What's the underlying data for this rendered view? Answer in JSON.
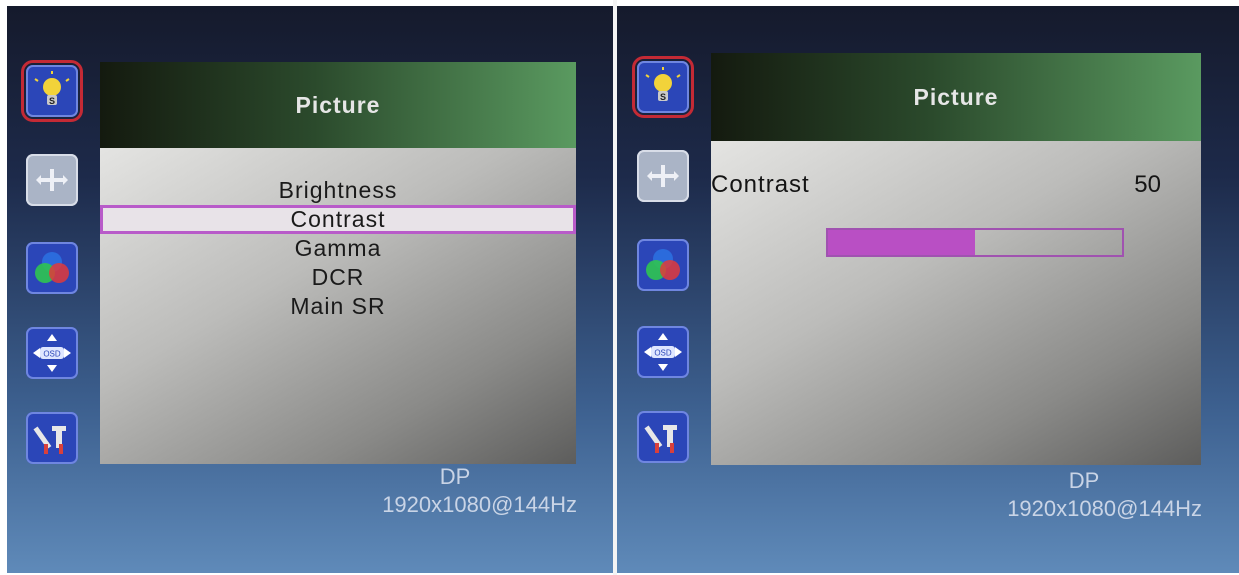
{
  "left_screen": {
    "menu_title": "Picture",
    "menu_items": [
      {
        "label": "Brightness"
      },
      {
        "label": "Contrast"
      },
      {
        "label": "Gamma"
      },
      {
        "label": "DCR"
      },
      {
        "label": "Main SR"
      }
    ],
    "selected_item": "Contrast",
    "source": "DP",
    "resolution": "1920x1080@144Hz"
  },
  "right_screen": {
    "menu_title": "Picture",
    "setting_label": "Contrast",
    "setting_value": "50",
    "setting_level_percent": 50,
    "source": "DP",
    "resolution": "1920x1080@144Hz"
  },
  "icon_bar": [
    {
      "name": "picture-icon",
      "badge": "S",
      "selected": true
    },
    {
      "name": "image-position-icon",
      "disabled": true
    },
    {
      "name": "color-icon"
    },
    {
      "name": "osd-position-icon",
      "badge": "OSD"
    },
    {
      "name": "tools-icon"
    }
  ],
  "colors": {
    "highlight": "#b85bc9",
    "bar_fill": "#b94fc4",
    "selected_icon_border": "#c42a35",
    "icon_bg": "#2b46b8"
  }
}
